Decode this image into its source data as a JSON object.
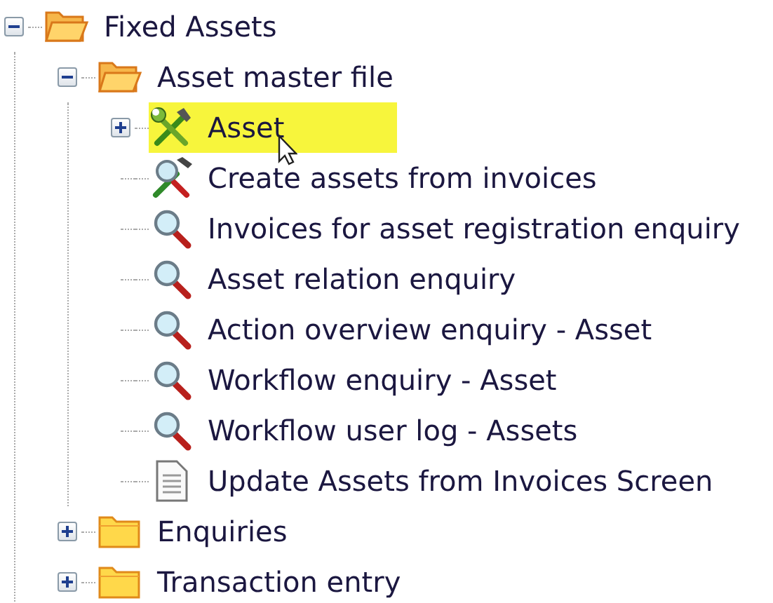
{
  "tree": [
    {
      "label": "Fixed Assets",
      "kind": "open-folder",
      "expanded": true,
      "selected": false,
      "children": [
        {
          "label": "Asset master file",
          "kind": "open-folder",
          "expanded": true,
          "selected": false,
          "children": [
            {
              "label": "Asset",
              "kind": "tools",
              "expanded": false,
              "selected": true
            },
            {
              "label": "Create assets from invoices",
              "kind": "tools-search",
              "selected": false
            },
            {
              "label": "Invoices for asset registration enquiry",
              "kind": "search",
              "selected": false
            },
            {
              "label": "Asset relation enquiry",
              "kind": "search",
              "selected": false
            },
            {
              "label": "Action overview enquiry - Asset",
              "kind": "search",
              "selected": false
            },
            {
              "label": "Workflow enquiry - Asset",
              "kind": "search",
              "selected": false
            },
            {
              "label": "Workflow user log - Assets",
              "kind": "search",
              "selected": false
            },
            {
              "label": "Update Assets from Invoices Screen",
              "kind": "document",
              "selected": false
            }
          ]
        },
        {
          "label": "Enquiries",
          "kind": "folder",
          "expanded": false,
          "selected": false
        },
        {
          "label": "Transaction entry",
          "kind": "folder",
          "expanded": false,
          "selected": false
        }
      ]
    }
  ]
}
